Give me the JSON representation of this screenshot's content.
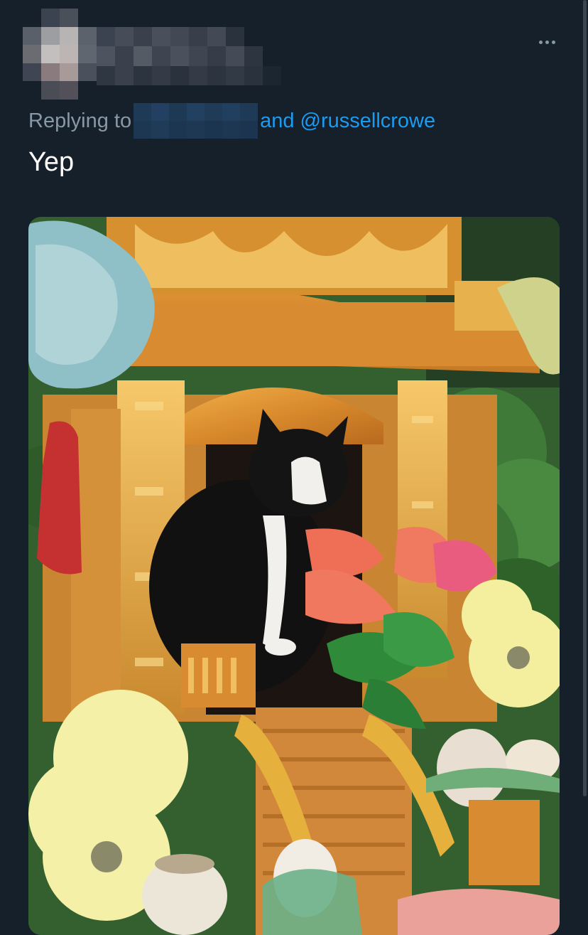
{
  "tweet": {
    "reply_prefix": "Replying to",
    "reply_suffix": "and @russellcrowe",
    "text": "Yep",
    "more_icon": "more-horizontal-icon"
  },
  "media": {
    "alt": "Cat sitting inside a golden spirit house"
  },
  "colors": {
    "background": "#15202b",
    "link": "#1d9bf0",
    "muted": "#8899a6",
    "text": "#ffffff"
  }
}
